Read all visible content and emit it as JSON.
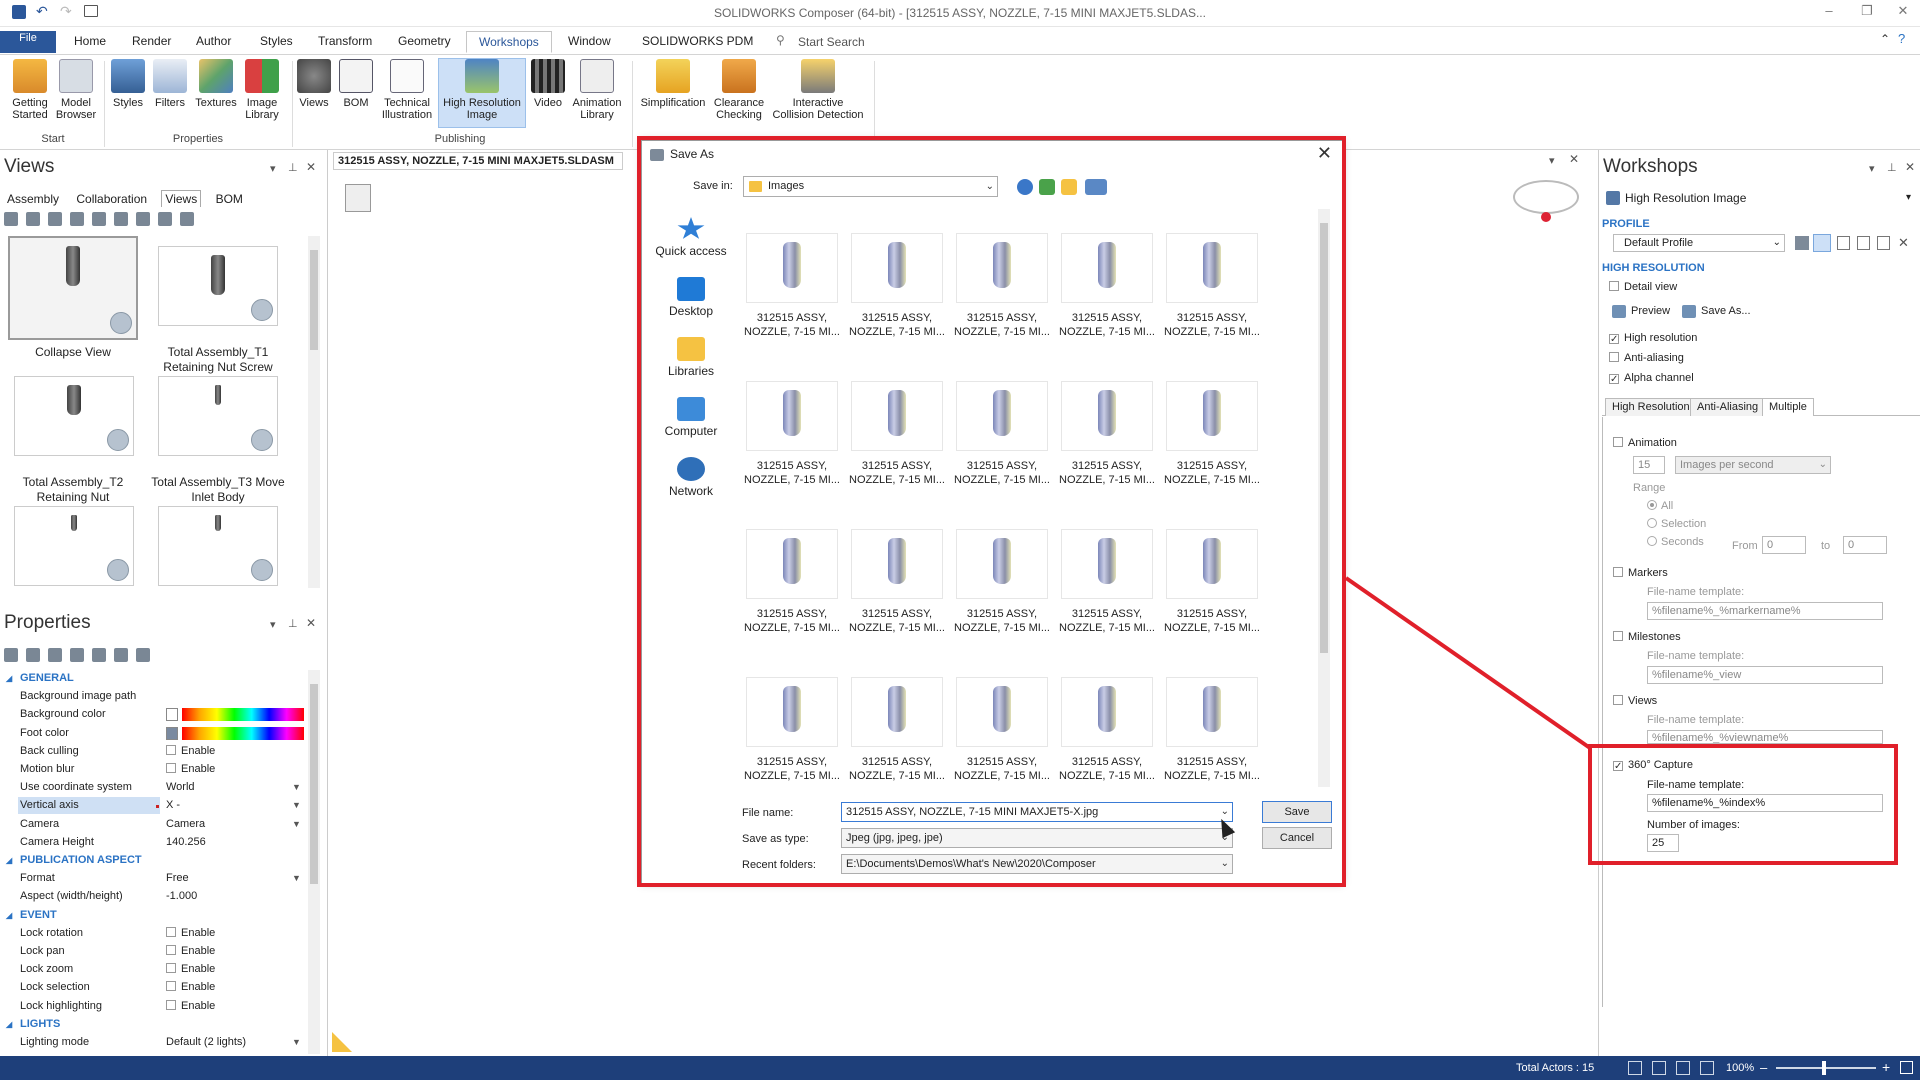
{
  "app": {
    "title": "SOLIDWORKS Composer (64-bit) - [312515 ASSY, NOZZLE, 7-15 MINI MAXJET5.SLDAS...",
    "search_placeholder": "Start Search"
  },
  "ribbon_tabs": [
    "File",
    "Home",
    "Render",
    "Author",
    "Styles",
    "Transform",
    "Geometry",
    "Workshops",
    "Window",
    "SOLIDWORKS PDM"
  ],
  "ribbon": {
    "start": {
      "group": "Start",
      "buttons": [
        "Getting\nStarted",
        "Model\nBrowser"
      ]
    },
    "properties": {
      "group": "Properties",
      "buttons": [
        "Styles",
        "Filters",
        "Textures",
        "Image\nLibrary"
      ]
    },
    "publishing": {
      "group": "Publishing",
      "buttons": [
        "Views",
        "BOM",
        "Technical\nIllustration",
        "High Resolution\nImage",
        "Video",
        "Animation\nLibrary"
      ]
    },
    "tools": {
      "buttons": [
        "Simplification",
        "Clearance\nChecking",
        "Interactive\nCollision Detection"
      ]
    }
  },
  "views_panel": {
    "title": "Views",
    "tabs": [
      "Assembly",
      "Collaboration",
      "Views",
      "BOM"
    ],
    "items": [
      "Collapse View",
      "Total Assembly_T1\nRetaining Nut Screw",
      "Total Assembly_T2\nRetaining Nut",
      "Total Assembly_T3 Move\nInlet Body"
    ]
  },
  "properties_panel": {
    "title": "Properties",
    "rows": [
      {
        "type": "cat",
        "k": "GENERAL"
      },
      {
        "k": "Background image path",
        "v": ""
      },
      {
        "k": "Background color",
        "v": "",
        "grad": true
      },
      {
        "k": "Foot color",
        "v": "",
        "grad": true
      },
      {
        "k": "Back culling",
        "v": "Enable",
        "cb": true
      },
      {
        "k": "Motion blur",
        "v": "Enable",
        "cb": true
      },
      {
        "k": "Use coordinate system",
        "v": "World",
        "dd": true
      },
      {
        "k": "Vertical axis",
        "v": "X -",
        "dd": true,
        "hl": true
      },
      {
        "k": "Camera",
        "v": "Camera",
        "dd": true
      },
      {
        "k": "Camera Height",
        "v": "140.256"
      },
      {
        "type": "cat",
        "k": "PUBLICATION ASPECT"
      },
      {
        "k": "Format",
        "v": "Free",
        "dd": true
      },
      {
        "k": "Aspect (width/height)",
        "v": "-1.000"
      },
      {
        "type": "cat",
        "k": "EVENT"
      },
      {
        "k": "Lock rotation",
        "v": "Enable",
        "cb": true
      },
      {
        "k": "Lock pan",
        "v": "Enable",
        "cb": true
      },
      {
        "k": "Lock zoom",
        "v": "Enable",
        "cb": true
      },
      {
        "k": "Lock selection",
        "v": "Enable",
        "cb": true
      },
      {
        "k": "Lock highlighting",
        "v": "Enable",
        "cb": true
      },
      {
        "type": "cat",
        "k": "LIGHTS"
      },
      {
        "k": "Lighting mode",
        "v": "Default (2 lights)",
        "dd": true
      }
    ]
  },
  "document_tab": "312515 ASSY, NOZZLE, 7-15 MINI MAXJET5.SLDASM",
  "dialog": {
    "title": "Save As",
    "save_in_label": "Save in:",
    "save_in_value": "Images",
    "places": [
      "Quick access",
      "Desktop",
      "Libraries",
      "Computer",
      "Network"
    ],
    "file_label_line1": "312515 ASSY,",
    "file_label_line2": "NOZZLE, 7-15 MI...",
    "file_name_label": "File name:",
    "file_name_value": "312515 ASSY, NOZZLE, 7-15 MINI MAXJET5-X.jpg",
    "save_as_type_label": "Save as type:",
    "save_as_type_value": "Jpeg (jpg, jpeg, jpe)",
    "recent_label": "Recent folders:",
    "recent_value": "E:\\Documents\\Demos\\What's New\\2020\\Composer",
    "save_btn": "Save",
    "cancel_btn": "Cancel"
  },
  "workshops": {
    "title": "Workshops",
    "workshop": "High Resolution Image",
    "profile_section": "PROFILE",
    "profile_value": "Default Profile",
    "hires_section": "HIGH RESOLUTION",
    "detail_view": "Detail view",
    "preview_btn": "Preview",
    "saveas_btn": "Save As...",
    "high_resolution": "High resolution",
    "anti_aliasing": "Anti-aliasing",
    "alpha_channel": "Alpha channel",
    "tabs": [
      "High Resolution",
      "Anti-Aliasing",
      "Multiple"
    ],
    "animation": "Animation",
    "fps_value": "15",
    "fps_unit": "Images per second",
    "range": "Range",
    "range_all": "All",
    "range_selection": "Selection",
    "range_seconds": "Seconds",
    "from": "From",
    "from_value": "0",
    "to": "to",
    "to_value": "0",
    "markers": "Markers",
    "template_label": "File-name template:",
    "markers_template": "%filename%_%markername%",
    "milestones": "Milestones",
    "milestones_template": "%filename%_view",
    "views": "Views",
    "views_template": "%filename%_%viewname%",
    "capture": "360° Capture",
    "capture_template_label": "File-name template:",
    "capture_template": "%filename%_%index%",
    "num_images_label": "Number of images:",
    "num_images": "25"
  },
  "status": {
    "total_actors": "Total Actors : 15",
    "zoom": "100%"
  }
}
